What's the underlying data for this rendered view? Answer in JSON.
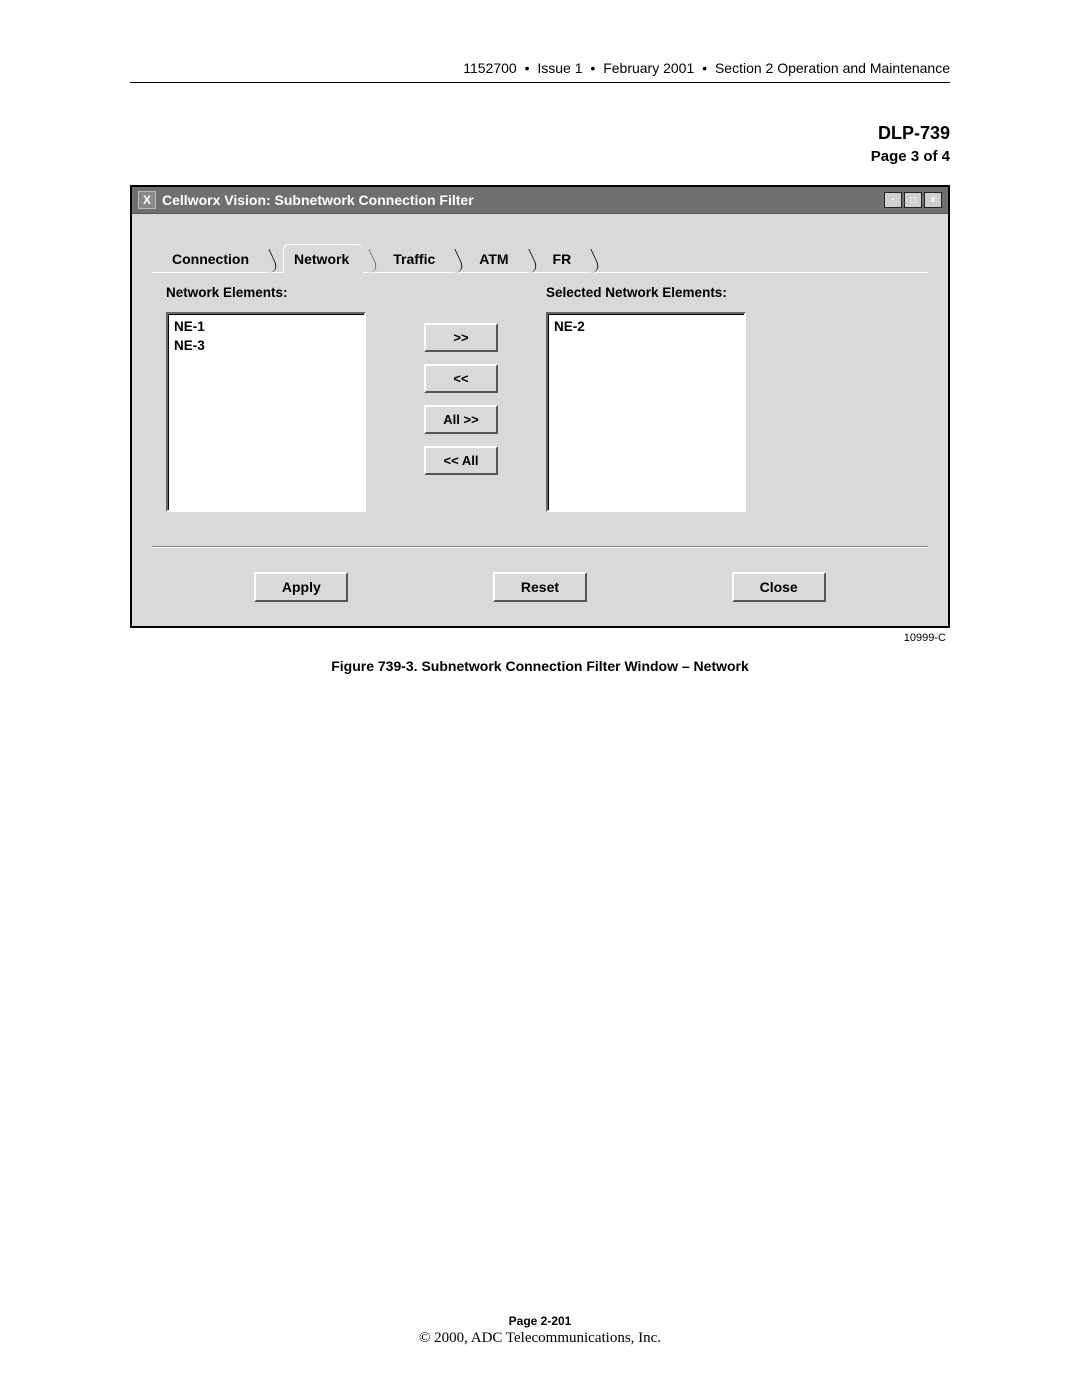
{
  "header": {
    "doc_number": "1152700",
    "issue": "Issue 1",
    "date": "February 2001",
    "section": "Section 2 Operation and Maintenance"
  },
  "dlp_title": "DLP-739",
  "page_of": "Page 3 of 4",
  "window": {
    "title_prefix": "X",
    "title": "Cellworx Vision: Subnetwork Connection Filter",
    "controls": {
      "minimize": "-",
      "maximize": "□",
      "close": "x"
    }
  },
  "tabs": {
    "connection": "Connection",
    "network": "Network",
    "traffic": "Traffic",
    "atm": "ATM",
    "fr": "FR"
  },
  "left_label": "Network Elements:",
  "right_label": "Selected Network Elements:",
  "left_items": [
    "NE-1",
    "NE-3"
  ],
  "right_items": [
    "NE-2"
  ],
  "buttons": {
    "add": ">>",
    "remove": "<<",
    "add_all": "All >>",
    "remove_all": "<< All",
    "apply": "Apply",
    "reset": "Reset",
    "close": "Close"
  },
  "figure_id": "10999-C",
  "caption": "Figure 739-3. Subnetwork Connection Filter Window – Network",
  "footer": {
    "page_number": "Page 2-201",
    "copyright": "© 2000, ADC Telecommunications, Inc."
  }
}
